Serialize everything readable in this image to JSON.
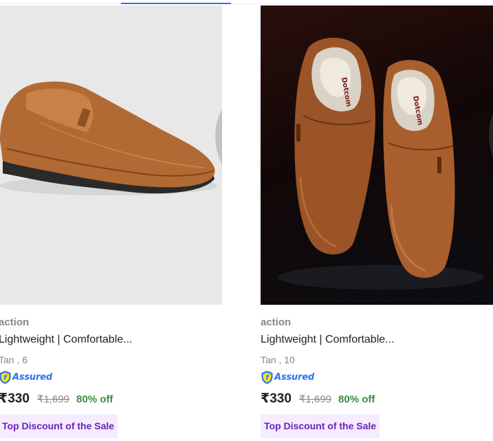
{
  "products": [
    {
      "brand": "action",
      "title": "Lightweight | Comfortable...",
      "variant": "Tan , 6",
      "assured_label": "Assured",
      "price": "₹330",
      "mrp": "₹1,699",
      "discount": "80% off",
      "tag": "Top Discount of the Sale",
      "wishlist_icon": "heart-icon",
      "wishlist_color": "#c2c2c2"
    },
    {
      "brand": "action",
      "title": "Lightweight | Comfortable...",
      "variant": "Tan , 10",
      "assured_label": "Assured",
      "price": "₹330",
      "mrp": "₹1,699",
      "discount": "80% off",
      "tag": "Top Discount of the Sale",
      "wishlist_icon": "heart-icon",
      "wishlist_color": "#c2c2c2"
    }
  ],
  "colors": {
    "accent": "#2874f0",
    "discount_green": "#388e3c",
    "tag_purple": "#6b21b8",
    "tag_bg": "#f5ecff",
    "muted_text": "#878787"
  }
}
